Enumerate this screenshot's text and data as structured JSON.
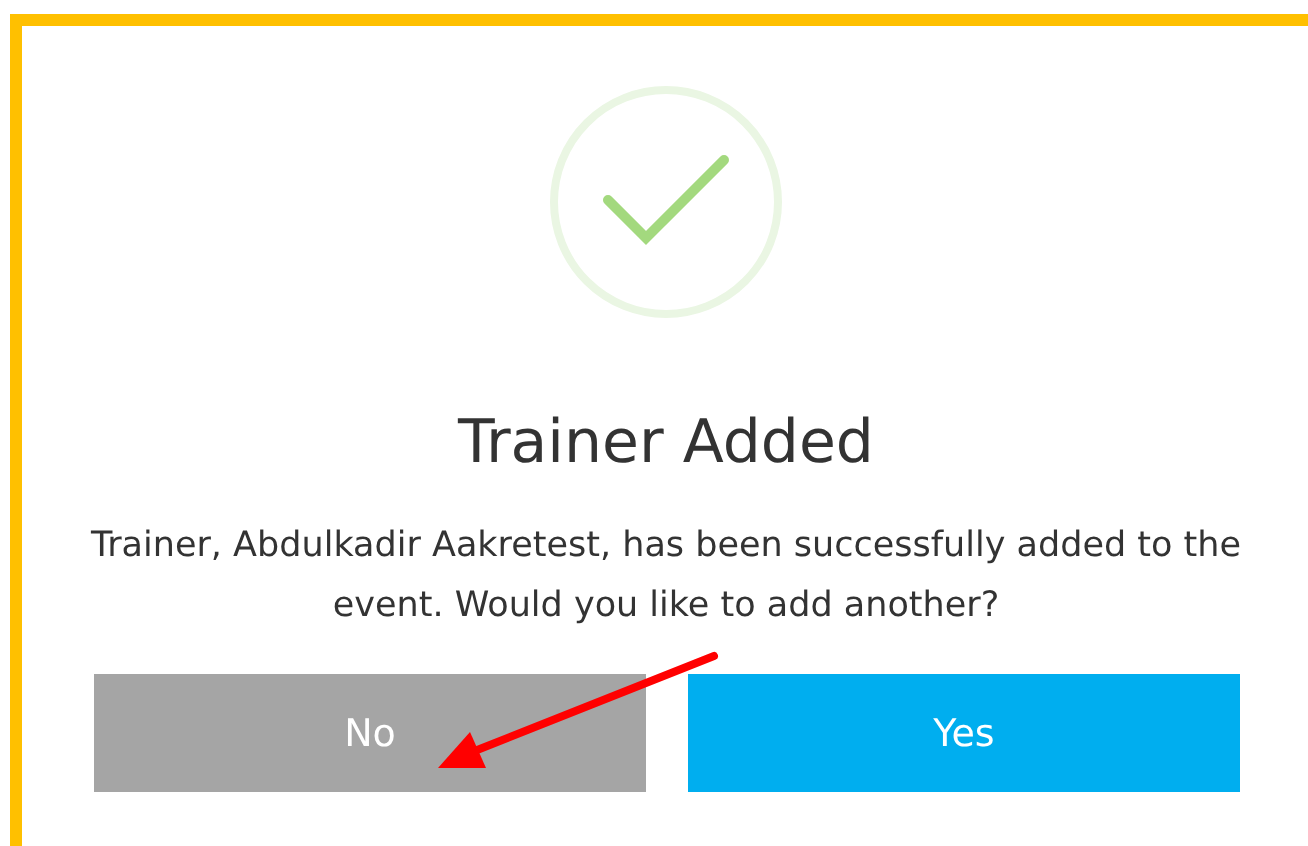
{
  "dialog": {
    "title": "Trainer Added",
    "message": "Trainer, Abdulkadir Aakretest, has been successfully added to the event. Would you like to add another?",
    "buttons": [
      {
        "label": "No",
        "kind": "secondary"
      },
      {
        "label": "Yes",
        "kind": "primary"
      }
    ]
  }
}
